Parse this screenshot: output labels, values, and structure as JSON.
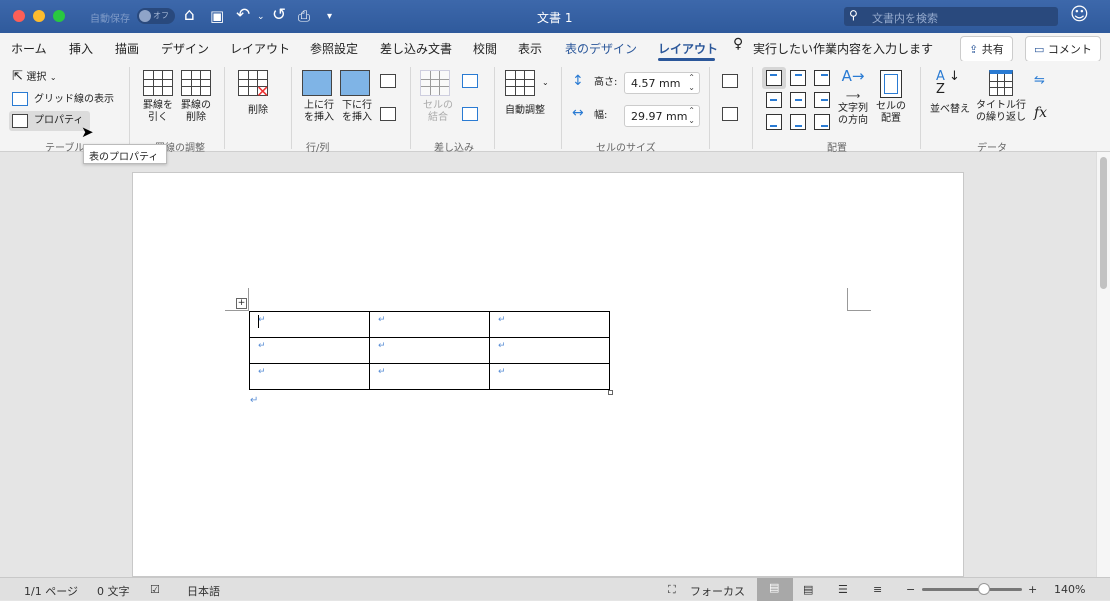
{
  "titlebar": {
    "autosave_label": "自動保存",
    "autosave_state": "オフ",
    "doc_title": "文書 1",
    "search_placeholder": "文書内を検索"
  },
  "tabs": [
    {
      "label": "ホーム"
    },
    {
      "label": "挿入"
    },
    {
      "label": "描画"
    },
    {
      "label": "デザイン"
    },
    {
      "label": "レイアウト"
    },
    {
      "label": "参照設定"
    },
    {
      "label": "差し込み文書"
    },
    {
      "label": "校閲"
    },
    {
      "label": "表示"
    },
    {
      "label": "表のデザイン"
    },
    {
      "label": "レイアウト",
      "active": true
    }
  ],
  "tell_me": "実行したい作業内容を入力します",
  "share_label": "共有",
  "comment_label": "コメント",
  "ribbon": {
    "table": {
      "select": "選択",
      "gridlines": "グリッド線の表示",
      "properties": "プロパティ",
      "group": "テーブル"
    },
    "draw": {
      "draw_borders": "罫線を\n引く",
      "erase": "罫線の\n削除",
      "group": "罫線の調整"
    },
    "delete": "削除",
    "rows": {
      "insert_above": "上に行\nを挿入",
      "insert_below": "下に行\nを挿入",
      "group": "行/列"
    },
    "merge": {
      "merge_cells": "セルの\n結合",
      "group": "差し込み"
    },
    "autofit": "自動調整",
    "cellsize": {
      "height_label": "高さ:",
      "height_value": "4.57 mm",
      "width_label": "幅:",
      "width_value": "29.97 mm",
      "group": "セルのサイズ"
    },
    "alignment": {
      "text_direction": "文字列\nの方向",
      "cell_margins": "セルの\n配置",
      "group": "配置"
    },
    "data": {
      "sort": "並べ替え",
      "repeat_header": "タイトル行\nの繰り返し",
      "formula": "fx",
      "group": "データ"
    }
  },
  "tooltip": "表のプロパティ",
  "table": {
    "rows": 3,
    "cols": 3,
    "mark": "↵"
  },
  "status": {
    "page": "1/1 ページ",
    "words": "0 文字",
    "language": "日本語",
    "focus": "フォーカス",
    "zoom": "140%",
    "zoom_level": 0.62
  },
  "colors": {
    "titlebar": "#2f5a9c",
    "accent": "#2b579a"
  }
}
